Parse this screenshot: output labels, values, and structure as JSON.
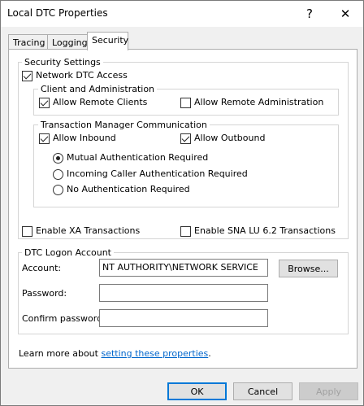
{
  "window": {
    "title": "Local DTC Properties",
    "help_glyph": "?",
    "close_glyph": "✕"
  },
  "tabs": [
    {
      "label": "Tracing"
    },
    {
      "label": "Logging"
    },
    {
      "label": "Security"
    }
  ],
  "security_settings": {
    "legend": "Security Settings",
    "network_dtc_access": {
      "label": "Network DTC Access",
      "checked": true
    },
    "client_admin": {
      "legend": "Client and Administration",
      "allow_remote_clients": {
        "label": "Allow Remote Clients",
        "checked": true
      },
      "allow_remote_admin": {
        "label": "Allow Remote Administration",
        "checked": false
      }
    },
    "tm_comm": {
      "legend": "Transaction Manager Communication",
      "allow_inbound": {
        "label": "Allow Inbound",
        "checked": true
      },
      "allow_outbound": {
        "label": "Allow Outbound",
        "checked": true
      },
      "mutual_auth": {
        "label": "Mutual Authentication Required",
        "selected": true
      },
      "incoming_caller": {
        "label": "Incoming Caller Authentication Required",
        "selected": false
      },
      "no_auth": {
        "label": "No Authentication Required",
        "selected": false
      }
    },
    "enable_xa": {
      "label": "Enable XA Transactions",
      "checked": false
    },
    "enable_sna": {
      "label": "Enable SNA LU 6.2 Transactions",
      "checked": false
    }
  },
  "logon": {
    "legend": "DTC Logon Account",
    "account_label": "Account:",
    "account_value": "NT AUTHORITY\\NETWORK SERVICE",
    "browse_label": "Browse...",
    "password_label": "Password:",
    "password_value": "",
    "confirm_label": "Confirm password:",
    "confirm_value": ""
  },
  "learn_more": {
    "prefix": "Learn more about ",
    "link": "setting these properties",
    "suffix": "."
  },
  "footer": {
    "ok": "OK",
    "cancel": "Cancel",
    "apply": "Apply"
  }
}
